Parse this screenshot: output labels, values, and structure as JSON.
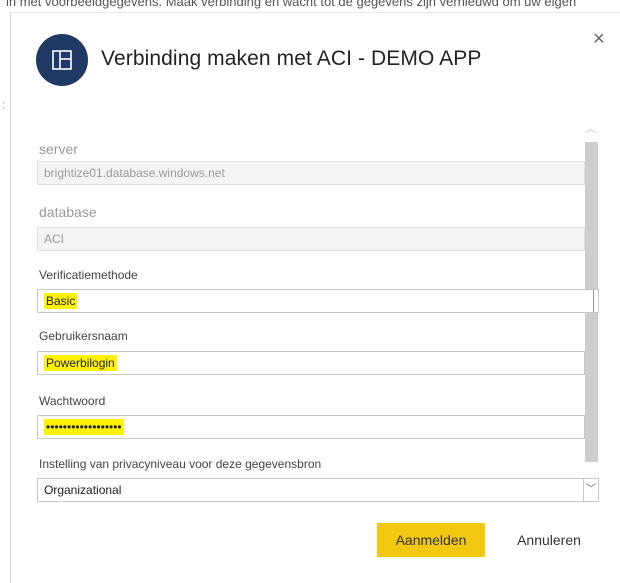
{
  "background": {
    "text": "in met voorbeeldgegevens. Maak verbinding en wacht tot de gegevens zijn vernieuwd om uw eigen"
  },
  "dialog": {
    "logo_icon": "powerbi-app-icon",
    "title": "Verbinding maken met ACI - DEMO APP",
    "close_symbol": "×",
    "fields": {
      "server_label": "server",
      "server_value": "brightize01.database.windows.net",
      "database_label": "database",
      "database_value": "ACI",
      "auth_label": "Verificatiemethode",
      "auth_value": "Basic",
      "username_label": "Gebruikersnaam",
      "username_value": "Powerbilogin",
      "password_label": "Wachtwoord",
      "password_value": "••••••••••••••••••",
      "privacy_label": "Instelling van privacyniveau voor deze gegevensbron",
      "privacy_value": "Organizational"
    },
    "buttons": {
      "signin": "Aanmelden",
      "cancel": "Annuleren"
    }
  },
  "colors": {
    "accent": "#f2c811",
    "logo_bg": "#1f3864",
    "highlight": "#fff200"
  }
}
